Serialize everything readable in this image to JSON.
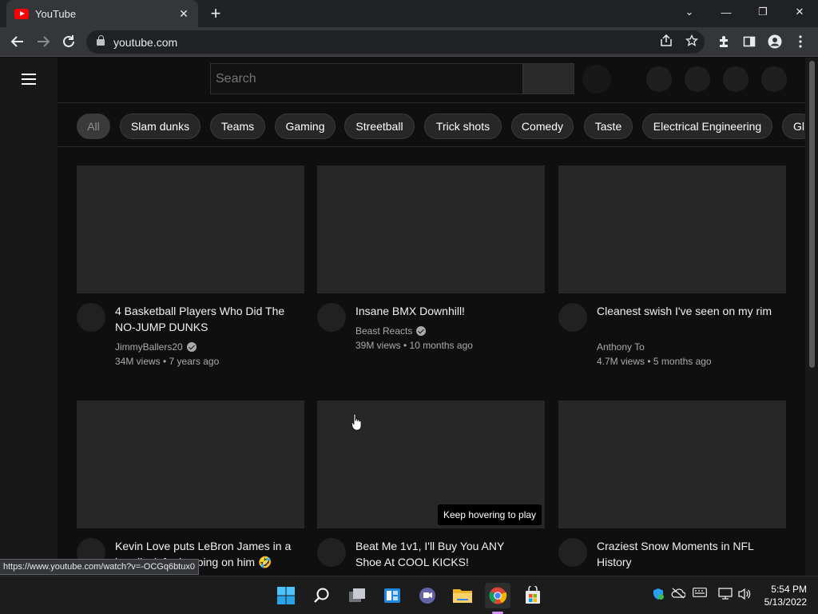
{
  "tab": {
    "title": "YouTube",
    "close": "✕"
  },
  "newtab": "+",
  "window": {
    "dropdown": "⌄",
    "minimize": "—",
    "restore": "❐",
    "close": "✕"
  },
  "address": {
    "url": "youtube.com"
  },
  "search": {
    "placeholder": "Search"
  },
  "chips": [
    "All",
    "Slam dunks",
    "Teams",
    "Gaming",
    "Streetball",
    "Trick shots",
    "Comedy",
    "Taste",
    "Electrical Engineering",
    "Gl"
  ],
  "videos": [
    {
      "title": "4 Basketball Players Who Did The NO-JUMP DUNKS",
      "channel": "JimmyBallers20",
      "verified": true,
      "meta": "34M views • 7 years ago"
    },
    {
      "title": "Insane BMX Downhill!",
      "channel": "Beast Reacts",
      "verified": true,
      "meta": "39M views • 10 months ago"
    },
    {
      "title": "Cleanest swish I've seen on my rim",
      "channel": "Anthony To",
      "verified": false,
      "meta": "4.7M views • 5 months ago"
    },
    {
      "title": "Kevin Love puts LeBron James in a headlock for jumping on him 🤣",
      "channel": "",
      "verified": false,
      "meta": ""
    },
    {
      "title": "Beat Me 1v1, I'll Buy You ANY Shoe At COOL KICKS!",
      "channel": "",
      "verified": false,
      "meta": ""
    },
    {
      "title": "Craziest Snow Moments in NFL History",
      "channel": "",
      "verified": false,
      "meta": ""
    }
  ],
  "hover_hint": "Keep hovering to play",
  "status_url": "https://www.youtube.com/watch?v=-OCGq6btux0",
  "clock": {
    "time": "5:54 PM",
    "date": "5/13/2022"
  },
  "colors": {
    "youtube_red": "#ff0000",
    "page_bg": "#0f0f0f",
    "chip_bg": "#272727"
  }
}
